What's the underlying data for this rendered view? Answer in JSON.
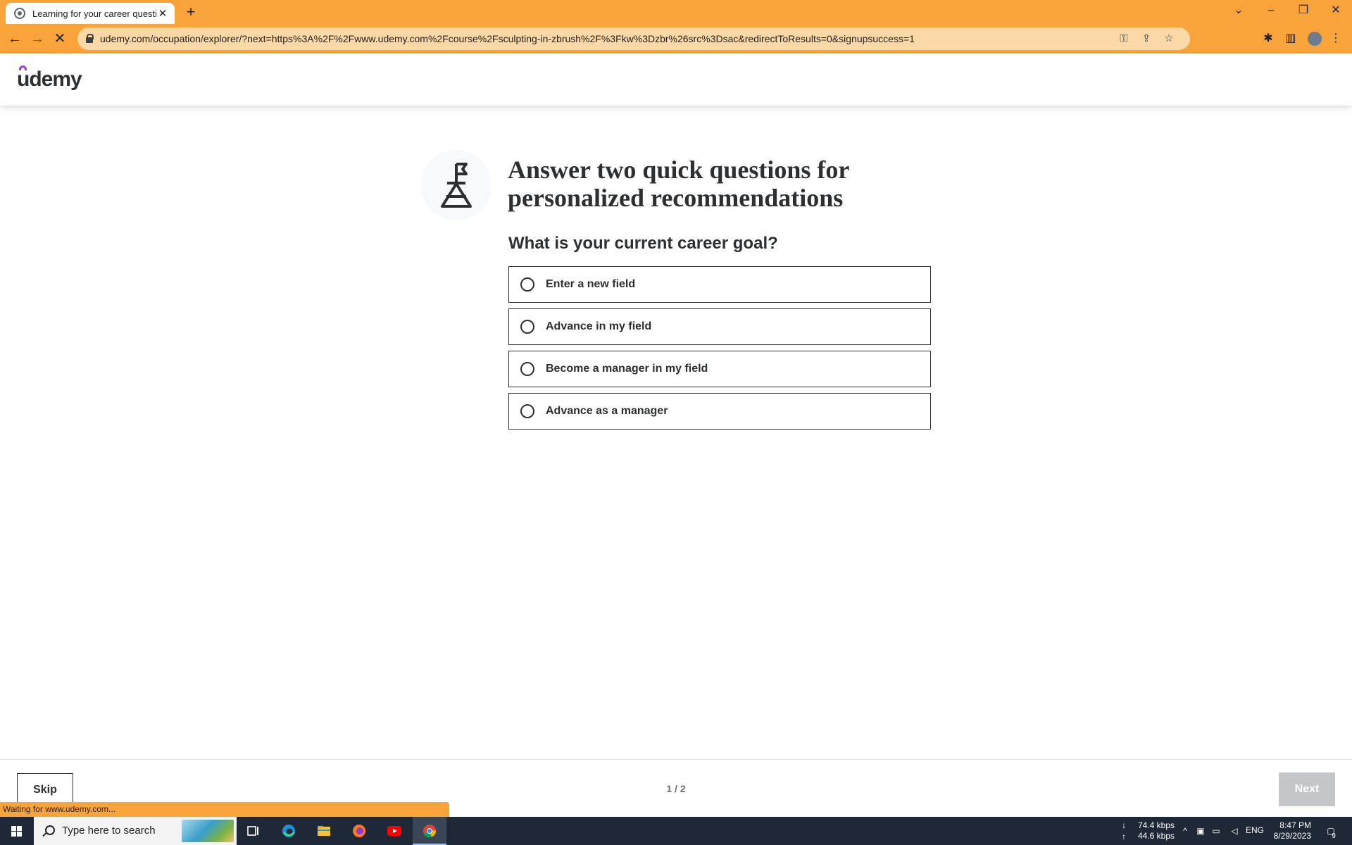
{
  "browser": {
    "tab_title": "Learning for your career questions",
    "url": "udemy.com/occupation/explorer/?next=https%3A%2F%2Fwww.udemy.com%2Fcourse%2Fsculpting-in-zbrush%2F%3Fkw%3Dzbr%26src%3Dsac&redirectToResults=0&signupsuccess=1",
    "status_text": "Waiting for www.udemy.com...",
    "chrome_color": "#f9a43a"
  },
  "site": {
    "logo_text": "udemy",
    "brand_color": "#a435f0"
  },
  "main": {
    "heading": "Answer two quick questions for personalized recommendations",
    "question": "What is your current career goal?",
    "options": [
      {
        "label": "Enter a new field",
        "selected": false
      },
      {
        "label": "Advance in my field",
        "selected": false
      },
      {
        "label": "Become a manager in my field",
        "selected": false
      },
      {
        "label": "Advance as a manager",
        "selected": false
      }
    ]
  },
  "footer": {
    "skip_label": "Skip",
    "progress": "1 / 2",
    "next_label": "Next",
    "next_disabled": true
  },
  "taskbar": {
    "search_placeholder": "Type here to search",
    "download_speed": "74.4 kbps",
    "upload_speed": "44.6 kbps",
    "language": "ENG",
    "time": "8:47 PM",
    "date": "8/29/2023",
    "notification_count": "9"
  }
}
